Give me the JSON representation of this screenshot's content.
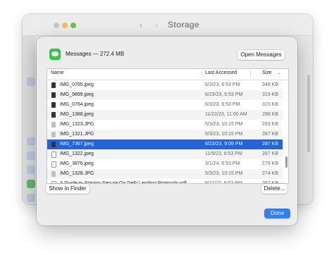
{
  "background": {
    "title": "Storage",
    "nav_back": "‹",
    "nav_forward": "›"
  },
  "sheet": {
    "app_label": "Messages — 272.4 MB",
    "open_button": "Open Messages",
    "show_finder_button": "Show in Finder",
    "delete_button": "Delete...",
    "done_button": "Done"
  },
  "table": {
    "columns": {
      "name": "Name",
      "date": "Last Accessed",
      "size": "Size"
    },
    "rows": [
      {
        "name": "IMG_0765.jpeg",
        "date": "6/3/23, 6:53 PM",
        "size": "348 KB",
        "thumb": "dark"
      },
      {
        "name": "IMG_9899.jpeg",
        "date": "6/23/23, 6:53 PM",
        "size": "319 KB",
        "thumb": "dark"
      },
      {
        "name": "IMG_0764.jpeg",
        "date": "6/3/23, 6:53 PM",
        "size": "315 KB",
        "thumb": "dark"
      },
      {
        "name": "IMG_1388.jpeg",
        "date": "11/22/23, 11:00 AM",
        "size": "298 KB",
        "thumb": "dark"
      },
      {
        "name": "IMG_1323.JPG",
        "date": "5/3/23, 10:15 PM",
        "size": "293 KB",
        "thumb": "light"
      },
      {
        "name": "IMG_1321.JPG",
        "date": "5/3/23, 10:15 PM",
        "size": "287 KB",
        "thumb": "light"
      },
      {
        "name": "IMG_7367.jpeg",
        "date": "6/23/23, 9:05 PM",
        "size": "287 KB",
        "thumb": "dark",
        "selected": true
      },
      {
        "name": "IMG_1322.jpeg",
        "date": "11/9/23, 6:53 PM",
        "size": "287 KB",
        "thumb": "doc"
      },
      {
        "name": "IMG_3876.jpeg",
        "date": "3/1/24, 6:53 PM",
        "size": "279 KB",
        "thumb": "doc"
      },
      {
        "name": "IMG_1328.JPG",
        "date": "5/3/23, 10:15 PM",
        "size": "274 KB",
        "thumb": "light"
      },
      {
        "name": "A Guide to Staying Secure On DeFi Lending Protocols.pdf",
        "date": "8/11/22, 6:53 PM",
        "size": "267 KB",
        "thumb": "doc"
      }
    ]
  }
}
